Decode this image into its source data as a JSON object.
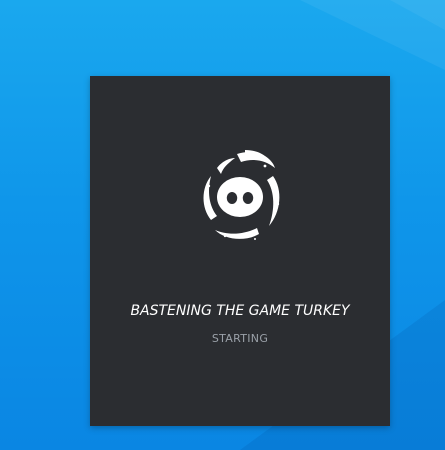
{
  "colors": {
    "desktop_background": "#0f96ea",
    "splash_background": "#2b2d31",
    "title_text": "#ffffff",
    "status_text": "#9aa0a8",
    "logo": "#ffffff"
  },
  "splash": {
    "logo_icon": "discord-wumpus-spinner-icon",
    "title": "BASTENING THE GAME TURKEY",
    "status": "STARTING"
  }
}
